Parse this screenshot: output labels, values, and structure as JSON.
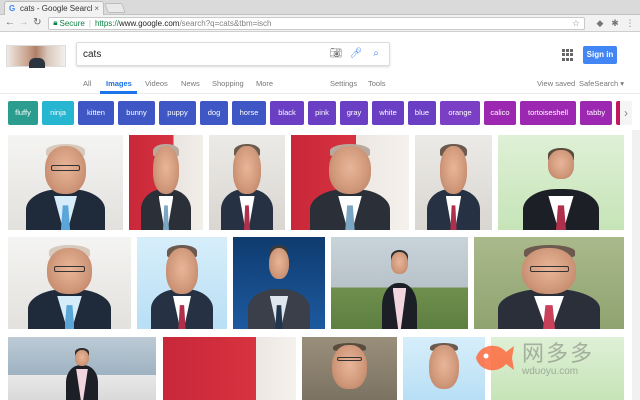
{
  "browser": {
    "tab_title": "cats - Google Search",
    "tab_close": "×",
    "secure_label": "Secure",
    "url_scheme": "https://",
    "url_host": "www.google.com",
    "url_path": "/search?q=cats&tbm=isch"
  },
  "search": {
    "query": "cats",
    "signin_label": "Sign in"
  },
  "nav": {
    "all": "All",
    "images": "Images",
    "videos": "Videos",
    "news": "News",
    "shopping": "Shopping",
    "more": "More",
    "settings": "Settings",
    "tools": "Tools",
    "view_saved": "View saved",
    "safesearch": "SafeSearch ▾"
  },
  "chips": [
    {
      "label": "fluffy",
      "color": "#2a9d8f"
    },
    {
      "label": "ninja",
      "color": "#26b6d1"
    },
    {
      "label": "kitten",
      "color": "#3f57c4"
    },
    {
      "label": "bunny",
      "color": "#3f57c4"
    },
    {
      "label": "puppy",
      "color": "#3f57c4"
    },
    {
      "label": "dog",
      "color": "#3f57c4"
    },
    {
      "label": "horse",
      "color": "#3f57c4"
    },
    {
      "label": "black",
      "color": "#6a3fc4"
    },
    {
      "label": "pink",
      "color": "#6a3fc4"
    },
    {
      "label": "gray",
      "color": "#6a3fc4"
    },
    {
      "label": "white",
      "color": "#6a3fc4"
    },
    {
      "label": "blue",
      "color": "#6a3fc4"
    },
    {
      "label": "orange",
      "color": "#7a3fc4"
    },
    {
      "label": "calico",
      "color": "#9c27b0"
    },
    {
      "label": "tortoiseshell",
      "color": "#9c27b0"
    },
    {
      "label": "tabby",
      "color": "#9c27b0"
    },
    {
      "label": "",
      "color": "#c2185b"
    }
  ],
  "watermark": {
    "cn": "网多多",
    "domain": "wduoyu.com"
  },
  "colors": {
    "accent": "#1a73e8",
    "signin": "#4285f4"
  }
}
